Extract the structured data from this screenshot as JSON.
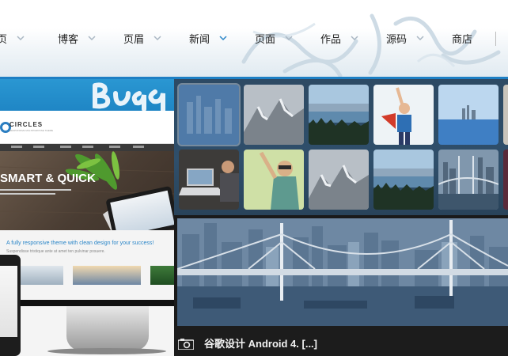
{
  "nav": {
    "items": [
      {
        "label": "页",
        "has_dropdown": true,
        "active": false
      },
      {
        "label": "博客",
        "has_dropdown": true,
        "active": false
      },
      {
        "label": "页眉",
        "has_dropdown": true,
        "active": false
      },
      {
        "label": "新闻",
        "has_dropdown": true,
        "active": true
      },
      {
        "label": "页面",
        "has_dropdown": true,
        "active": false
      },
      {
        "label": "作品",
        "has_dropdown": true,
        "active": false
      },
      {
        "label": "源码",
        "has_dropdown": true,
        "active": false
      },
      {
        "label": "商店",
        "has_dropdown": false,
        "active": false
      }
    ]
  },
  "colors": {
    "accent": "#1d7fc4",
    "nav_chevron": "#a9b6c2",
    "nav_chevron_active": "#2b86c8",
    "gallery_bg": "#2d4a64",
    "caption_bg": "#1c1c1c"
  },
  "left_slide": {
    "brush_text": "Bug",
    "site_name": "CIRCLES",
    "site_sub": "RESPONSIVE MULTIPURPOSE THEME",
    "hero_title": "SMART & QUICK",
    "tagline": "A fully responsive theme with clean design for your success!",
    "tagline_sub": "Suspendisse tristique ante at amet ten pulvinar posuere."
  },
  "gallery": {
    "thumbnails": [
      {
        "name": "city-skyline",
        "active": true
      },
      {
        "name": "snow-mountains"
      },
      {
        "name": "lake-forest"
      },
      {
        "name": "kid-superhero"
      },
      {
        "name": "harbor-city"
      },
      {
        "name": "partial"
      },
      {
        "name": "laptop-desk"
      },
      {
        "name": "woman-sunglasses"
      },
      {
        "name": "snow-mountains-2"
      },
      {
        "name": "lake-forest-2"
      },
      {
        "name": "bridge-city"
      },
      {
        "name": "partial-2"
      }
    ],
    "caption": "谷歌设计 Android 4. [...]",
    "caption_icon": "camera-icon"
  }
}
